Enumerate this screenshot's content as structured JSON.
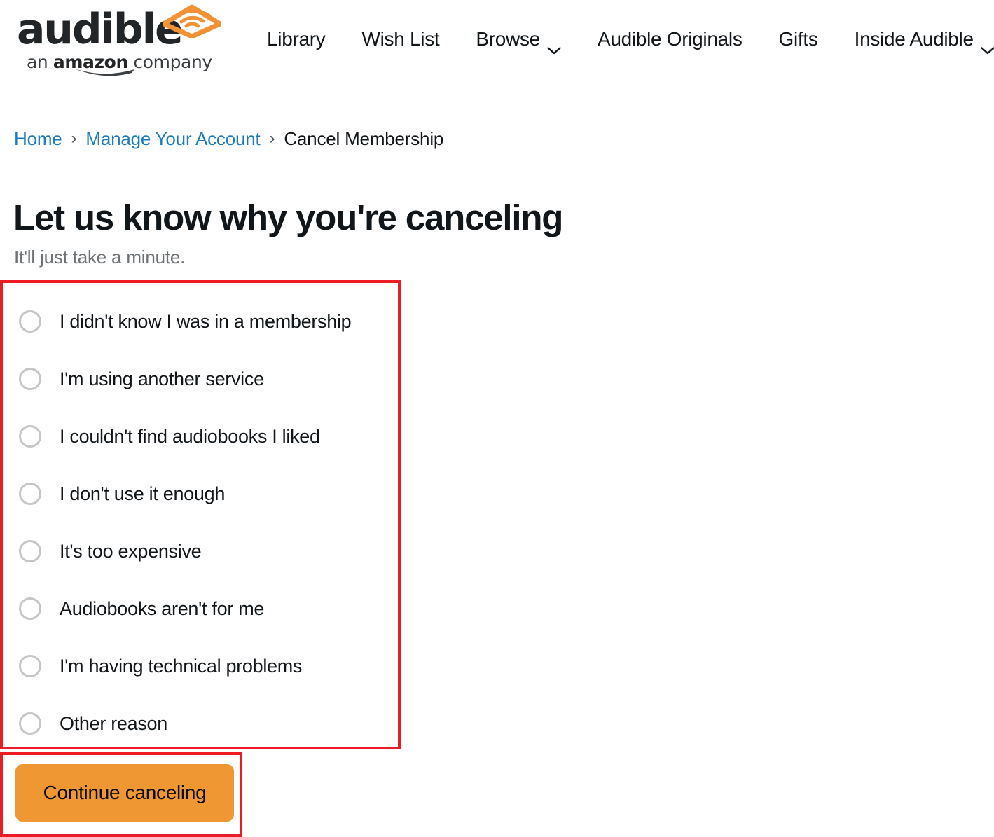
{
  "brand": {
    "wordmark": "audible",
    "tagline_prefix": "an ",
    "tagline_bold": "amazon",
    "tagline_suffix": " company",
    "logo_icon": "audible-open-book-soundwave-icon",
    "accent_orange": "#ef9833"
  },
  "nav": {
    "items": [
      {
        "label": "Library",
        "has_caret": false,
        "icon": ""
      },
      {
        "label": "Wish List",
        "has_caret": false,
        "icon": ""
      },
      {
        "label": "Browse",
        "has_caret": true,
        "icon": "chevron-down-icon"
      },
      {
        "label": "Audible Originals",
        "has_caret": false,
        "icon": ""
      },
      {
        "label": "Gifts",
        "has_caret": false,
        "icon": ""
      },
      {
        "label": "Inside Audible",
        "has_caret": true,
        "icon": "chevron-down-icon"
      }
    ]
  },
  "breadcrumb": {
    "separator": "›",
    "items": [
      {
        "label": "Home",
        "is_link": true
      },
      {
        "label": "Manage Your Account",
        "is_link": true
      },
      {
        "label": "Cancel Membership",
        "is_link": false
      }
    ],
    "link_color": "#1b7bbd"
  },
  "heading": {
    "title": "Let us know why you're canceling",
    "subtitle": "It'll just take a minute."
  },
  "cancel_reasons": {
    "options": [
      {
        "label": "I didn't know I was in a membership",
        "selected": false
      },
      {
        "label": "I'm using another service",
        "selected": false
      },
      {
        "label": "I couldn't find audiobooks I liked",
        "selected": false
      },
      {
        "label": "I don't use it enough",
        "selected": false
      },
      {
        "label": "It's too expensive",
        "selected": false
      },
      {
        "label": "Audiobooks aren't for me",
        "selected": false
      },
      {
        "label": "I'm having technical problems",
        "selected": false
      },
      {
        "label": "Other reason",
        "selected": false
      }
    ]
  },
  "actions": {
    "continue_label": "Continue canceling"
  },
  "annotations": {
    "highlight_color": "#ed1c24",
    "boxes": [
      {
        "name": "cancel-reasons-group"
      },
      {
        "name": "continue-canceling-button"
      }
    ]
  }
}
